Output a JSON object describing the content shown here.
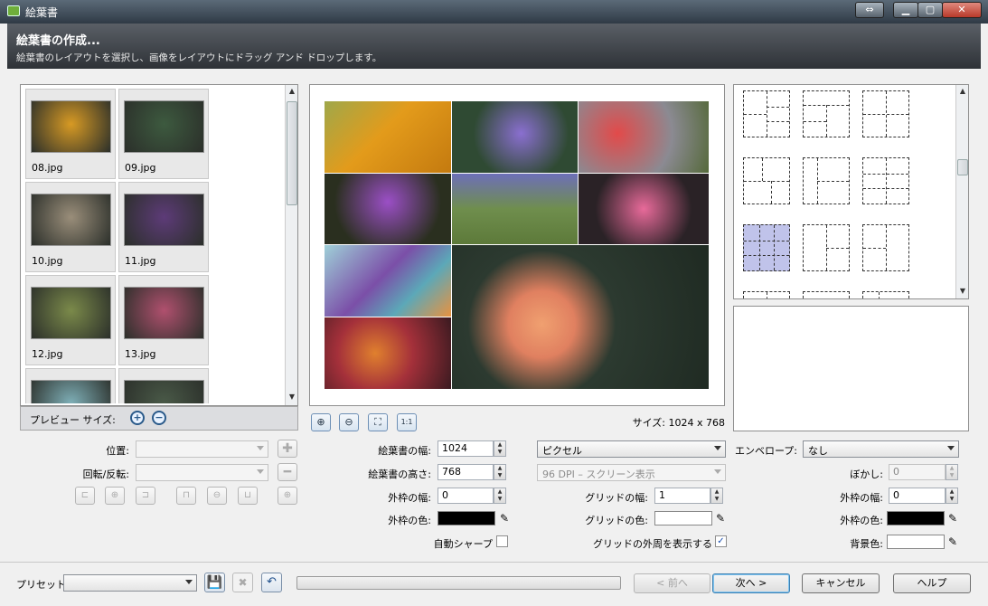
{
  "window": {
    "title": "絵葉書"
  },
  "header": {
    "title": "絵葉書の作成...",
    "subtitle": "絵葉書のレイアウトを選択し、画像をレイアウトにドラッグ アンド ドロップします。"
  },
  "thumbnails": [
    {
      "label": "08.jpg",
      "color": "#d79a24"
    },
    {
      "label": "09.jpg",
      "color": "#3d5a3f"
    },
    {
      "label": "10.jpg",
      "color": "#9a8e7a"
    },
    {
      "label": "11.jpg",
      "color": "#5d3b78"
    },
    {
      "label": "12.jpg",
      "color": "#7b8a4a"
    },
    {
      "label": "13.jpg",
      "color": "#b0506e"
    },
    {
      "label": "",
      "color": "#7fb0b8"
    },
    {
      "label": "",
      "color": "#4a5a48"
    }
  ],
  "preview_size": {
    "label": "プレビュー サイズ:"
  },
  "canvas": {
    "size_text": "サイズ: 1024 x 768"
  },
  "controls": {
    "position_label": "位置:",
    "rotate_label": "回転/反転:",
    "width_label": "絵葉書の幅:",
    "width_value": "1024",
    "height_label": "絵葉書の高さ:",
    "height_value": "768",
    "border_width_label": "外枠の幅:",
    "border_width_value": "0",
    "border_color_label": "外枠の色:",
    "border_color": "#000000",
    "auto_sharpen_label": "自動シャープ",
    "auto_sharpen_checked": false,
    "unit_select": "ピクセル",
    "dpi_select": "96 DPI – スクリーン表示",
    "grid_width_label": "グリッドの幅:",
    "grid_width_value": "1",
    "grid_color_label": "グリッドの色:",
    "grid_color": "#ffffff",
    "grid_outer_label": "グリッドの外周を表示する",
    "grid_outer_checked": true,
    "envelope_label": "エンベロープ:",
    "envelope_select": "なし",
    "blur_label": "ぼかし:",
    "blur_value": "0",
    "env_border_width_label": "外枠の幅:",
    "env_border_width_value": "0",
    "env_border_color_label": "外枠の色:",
    "env_border_color": "#000000",
    "bg_color_label": "背景色:",
    "bg_color": "#ffffff"
  },
  "bottom": {
    "preset_label": "プリセット:",
    "prev_label": "< 前へ",
    "next_label": "次へ >",
    "cancel_label": "キャンセル",
    "help_label": "ヘルプ"
  },
  "colors": {
    "selected_layout": "#c0c3ea",
    "canvas_bg": "#ffffff"
  }
}
